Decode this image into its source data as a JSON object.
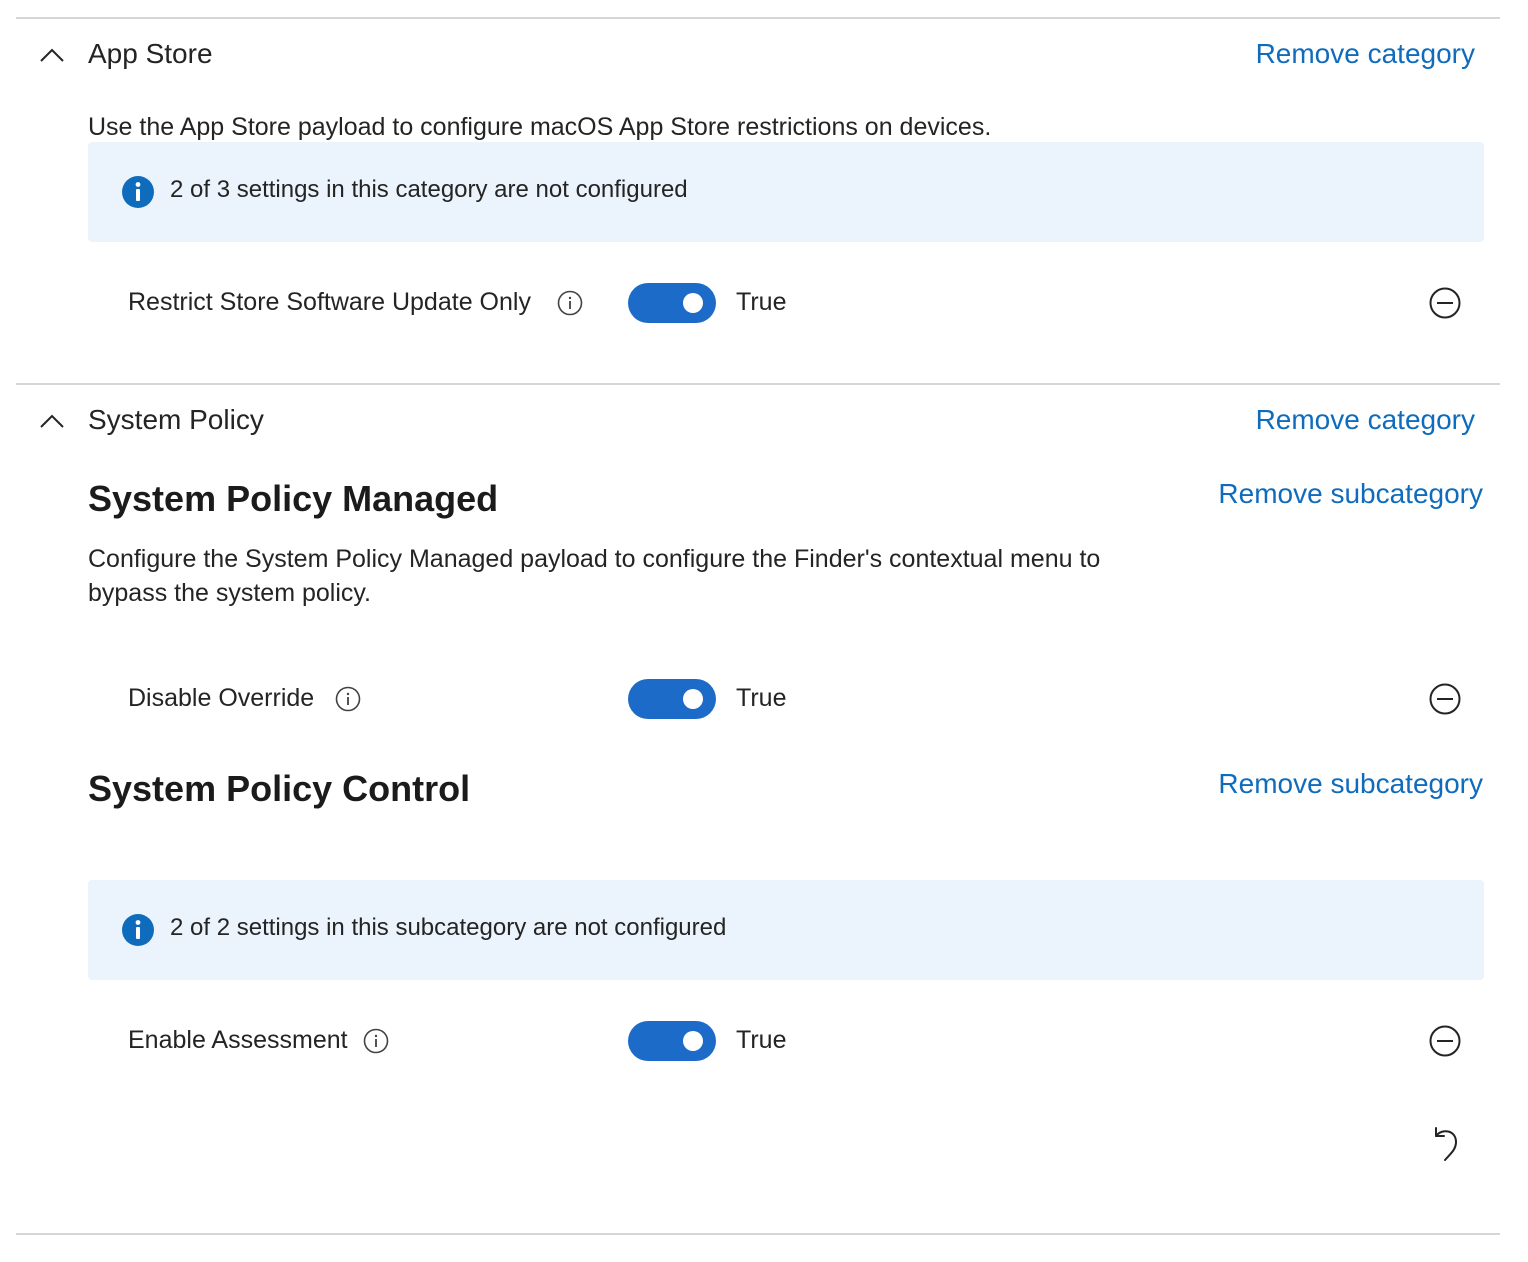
{
  "categories": [
    {
      "title": "App Store",
      "remove_label": "Remove category",
      "description": "Use the App Store payload to configure macOS App Store restrictions on devices.",
      "info": "2 of 3 settings in this category are not configured",
      "settings": [
        {
          "label": "Restrict Store Software Update Only",
          "value": "True",
          "enabled": true
        }
      ]
    },
    {
      "title": "System Policy",
      "remove_label": "Remove category",
      "subcategories": [
        {
          "title": "System Policy Managed",
          "remove_label": "Remove subcategory",
          "description": "Configure the System Policy Managed payload to configure the Finder's contextual menu to bypass the system policy.",
          "settings": [
            {
              "label": "Disable Override",
              "value": "True",
              "enabled": true
            }
          ]
        },
        {
          "title": "System Policy Control",
          "remove_label": "Remove subcategory",
          "info": "2 of 2 settings in this subcategory are not configured",
          "settings": [
            {
              "label": "Enable Assessment",
              "value": "True",
              "enabled": true
            }
          ]
        }
      ]
    }
  ],
  "icons": {
    "collapse": "chevron-up-icon",
    "info": "info-icon",
    "help": "info-circle-icon",
    "remove": "minus-circle-icon",
    "reset": "undo-icon"
  },
  "colors": {
    "link": "#0f6cbd",
    "toggle_on": "#1c6bc8",
    "info_bar": "#ebf3fc",
    "info_icon": "#0f6cbd",
    "divider": "#d6d6d6"
  }
}
